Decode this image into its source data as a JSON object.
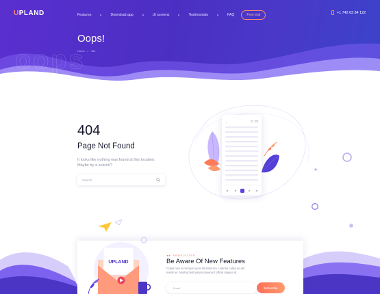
{
  "header": {
    "logo_accent": "U",
    "logo_rest": "PLAND",
    "nav": [
      "Features",
      "Download app",
      "UI screens",
      "Testimonials",
      "FAQ"
    ],
    "trial_label": "Free trial",
    "phone": "+1 742 63 84 122"
  },
  "hero": {
    "title": "Oops!",
    "breadcrumbs": [
      "Home",
      "404"
    ],
    "watermark": "oops"
  },
  "error": {
    "code": "404",
    "title": "Page Not Found",
    "text": "It looks like nothing was found at this location. Maybe try a search?",
    "search_placeholder": "Search"
  },
  "newsletter": {
    "brand": "UPLAND",
    "tag": "NEWSLETTER",
    "title": "Be Aware Of New Features",
    "text": "Culpa non ex tempor qui nulla laborum. Laboris culpa ad elit minim et. Nostrud elit ipsum deserunt officia magna id.",
    "email_placeholder": "Email",
    "subscribe_label": "Subscribe"
  },
  "colors": {
    "hero_purple": "#5a2fcf",
    "hero_blue": "#3b43c9",
    "accent_orange": "#ff7b57",
    "lilac": "#c9b8ff"
  },
  "icons": [
    "phone-icon",
    "search-icon",
    "paper-plane-icon",
    "envelope-icon",
    "play-icon",
    "mug-icon"
  ]
}
